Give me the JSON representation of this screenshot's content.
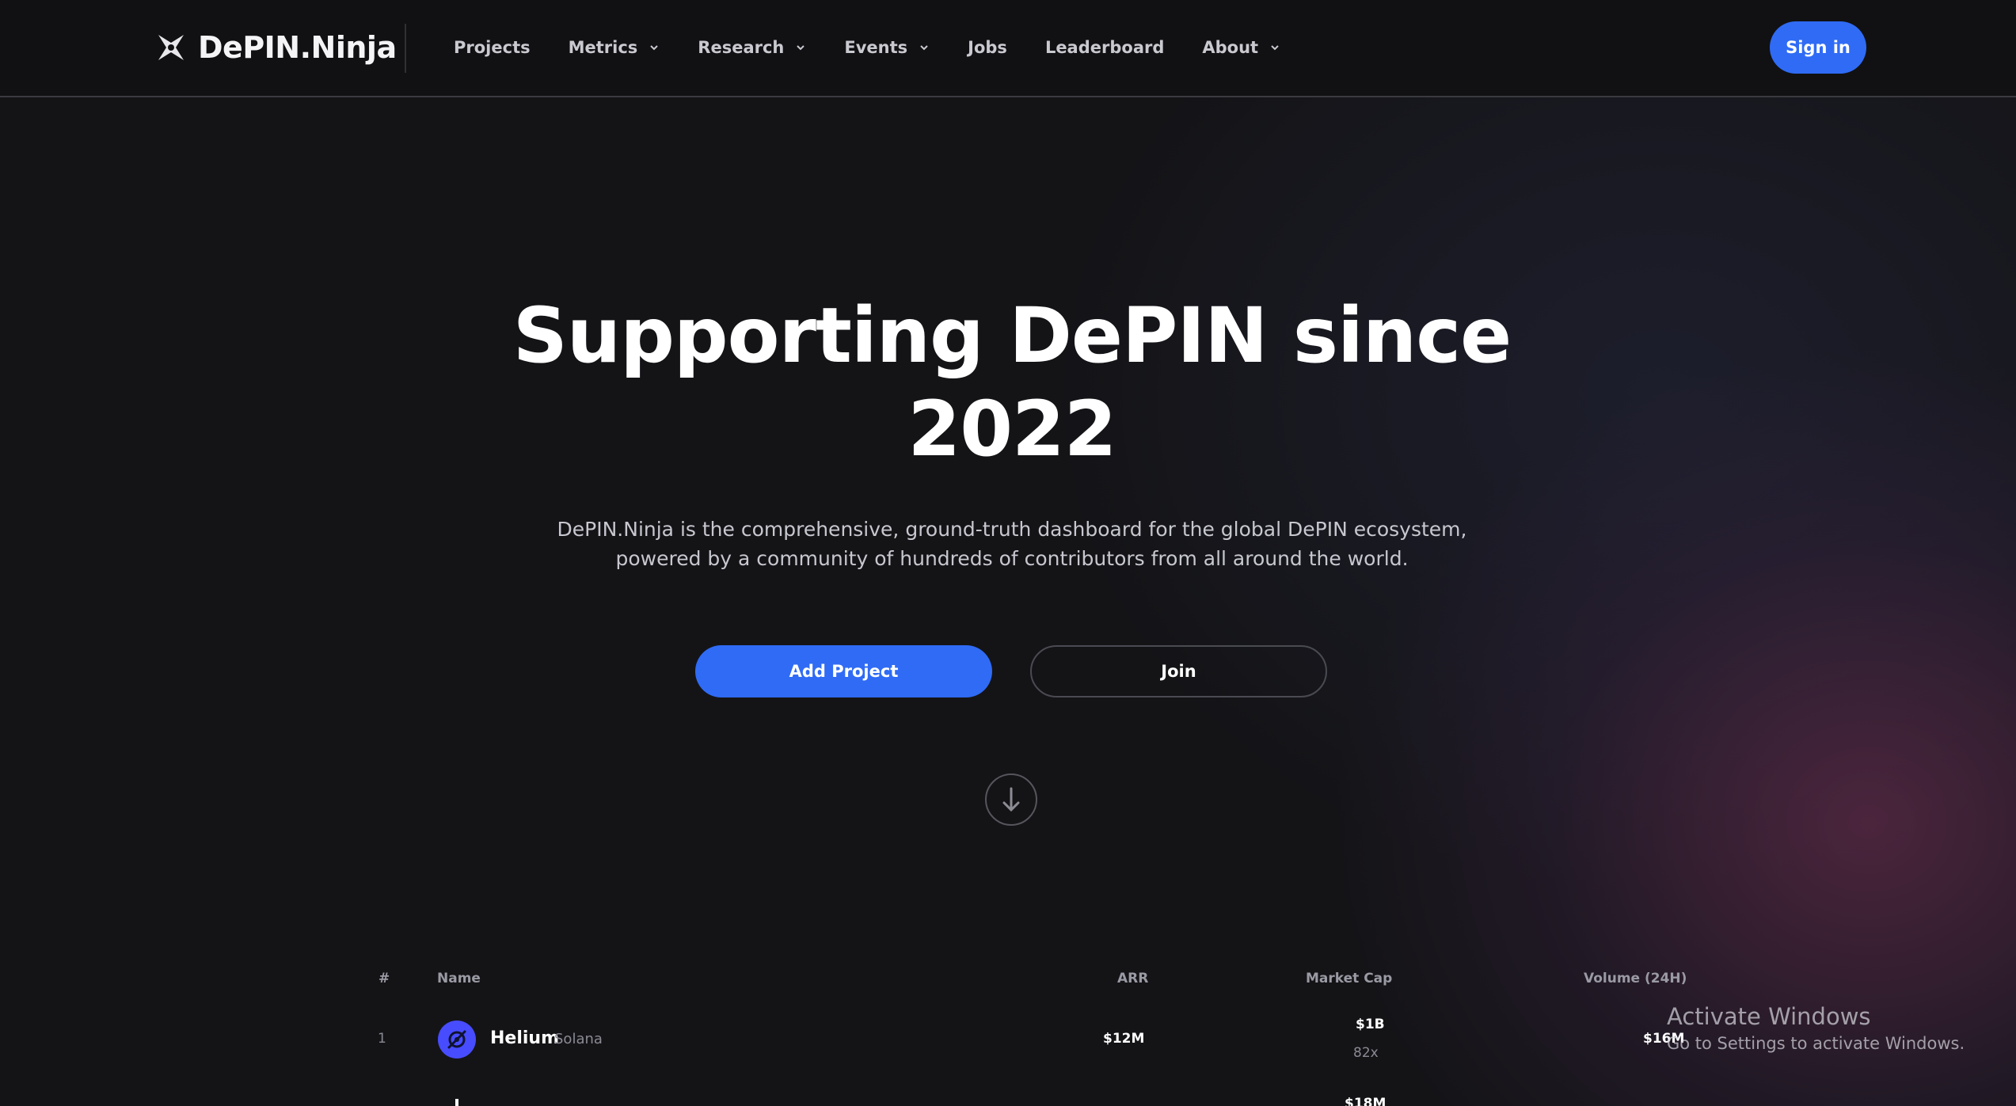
{
  "brand": {
    "name": "DePIN.Ninja",
    "logo_icon": "ninja-star-icon"
  },
  "nav": {
    "items": [
      {
        "label": "Projects",
        "has_dropdown": false
      },
      {
        "label": "Metrics",
        "has_dropdown": true
      },
      {
        "label": "Research",
        "has_dropdown": true
      },
      {
        "label": "Events",
        "has_dropdown": true
      },
      {
        "label": "Jobs",
        "has_dropdown": false
      },
      {
        "label": "Leaderboard",
        "has_dropdown": false
      },
      {
        "label": "About",
        "has_dropdown": true
      }
    ],
    "sign_in_label": "Sign in"
  },
  "hero": {
    "title_line1": "Supporting DePIN since",
    "title_line2": "2022",
    "subtitle_line1": "DePIN.Ninja is the comprehensive, ground-truth dashboard for the global DePIN ecosystem,",
    "subtitle_line2": "powered by a community of hundreds of contributors from all around the world.",
    "primary_button": "Add Project",
    "secondary_button": "Join",
    "scroll_icon": "arrow-down-icon"
  },
  "table": {
    "columns": {
      "rank": "#",
      "name": "Name",
      "arr": "ARR",
      "market_cap": "Market Cap",
      "volume": "Volume (24H)"
    },
    "rows": [
      {
        "rank": "1",
        "name": "Helium",
        "chain": "Solana",
        "arr": "$12M",
        "market_cap": "$1B",
        "multiple": "82x",
        "volume": "$16M"
      },
      {
        "market_cap": "$18M"
      }
    ]
  },
  "watermark": {
    "title": "Activate Windows",
    "subtitle": "Go to Settings to activate Windows."
  },
  "colors": {
    "accent": "#2f6bf5",
    "background": "#141417",
    "helium_logo": "#474dff"
  }
}
